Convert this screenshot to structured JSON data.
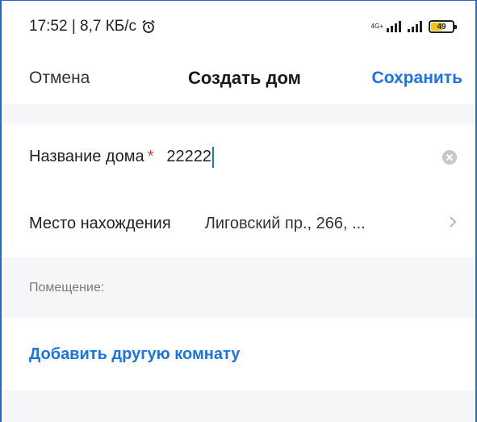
{
  "status_bar": {
    "time_speed": "17:52 | 8,7 КБ/с",
    "network_label": "4G+",
    "battery_level": "49"
  },
  "header": {
    "cancel_label": "Отмена",
    "title": "Создать дом",
    "save_label": "Сохранить"
  },
  "form": {
    "name_label": "Название дома",
    "required_mark": "*",
    "name_value": "22222",
    "location_label": "Место нахождения",
    "location_value": "Лиговский пр., 266, ..."
  },
  "rooms": {
    "section_label": "Помещение:",
    "add_room_label": "Добавить другую комнату"
  },
  "colors": {
    "accent": "#1a73e8",
    "required": "#e53935",
    "background": "#f5f6f8"
  },
  "icons": [
    "alarm-icon",
    "signal-icon",
    "battery-icon",
    "clear-icon",
    "chevron-right-icon"
  ]
}
